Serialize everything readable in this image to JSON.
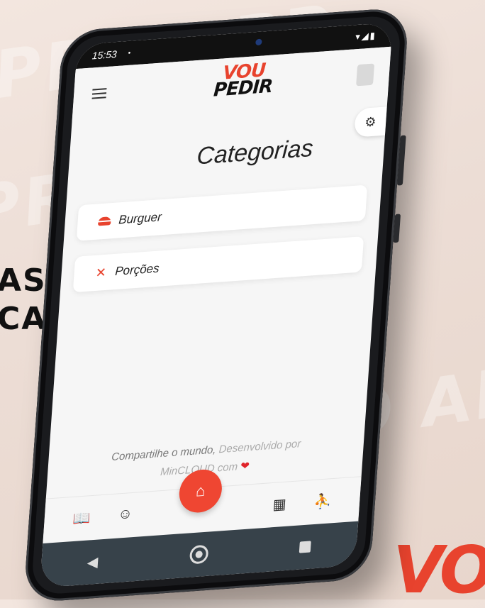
{
  "background": {
    "side_line1": "AS",
    "side_line2": "CAIS...",
    "watermark_word": "PRO APP",
    "corner_brand": "VO"
  },
  "statusbar": {
    "time": "15:53",
    "notification_dot": "•",
    "icons": "▾◢▮"
  },
  "appbar": {
    "logo_line1": "VOU",
    "logo_line2": "PEDIR"
  },
  "page": {
    "title": "Categorias"
  },
  "categories": [
    {
      "label": "Burguer",
      "icon": "burger-icon"
    },
    {
      "label": "Porções",
      "icon": "close-x-icon"
    }
  ],
  "footer": {
    "share_text": "Compartilhe o mundo,",
    "dev_text": "Desenvolvido por",
    "company": "MinCLOUD com",
    "heart": "❤"
  },
  "tabs": [
    {
      "icon": "menu-book-icon",
      "glyph": "📖"
    },
    {
      "icon": "smiley-icon",
      "glyph": "☺"
    },
    {
      "icon": "home-icon",
      "glyph": "⌂"
    },
    {
      "icon": "building-icon",
      "glyph": "▦"
    },
    {
      "icon": "person-icon",
      "glyph": "⛹"
    }
  ],
  "navbar": {
    "back_glyph": "◀"
  },
  "colors": {
    "accent": "#e8432e",
    "navbar": "#37424a",
    "screen_bg": "#f6f6f6"
  }
}
